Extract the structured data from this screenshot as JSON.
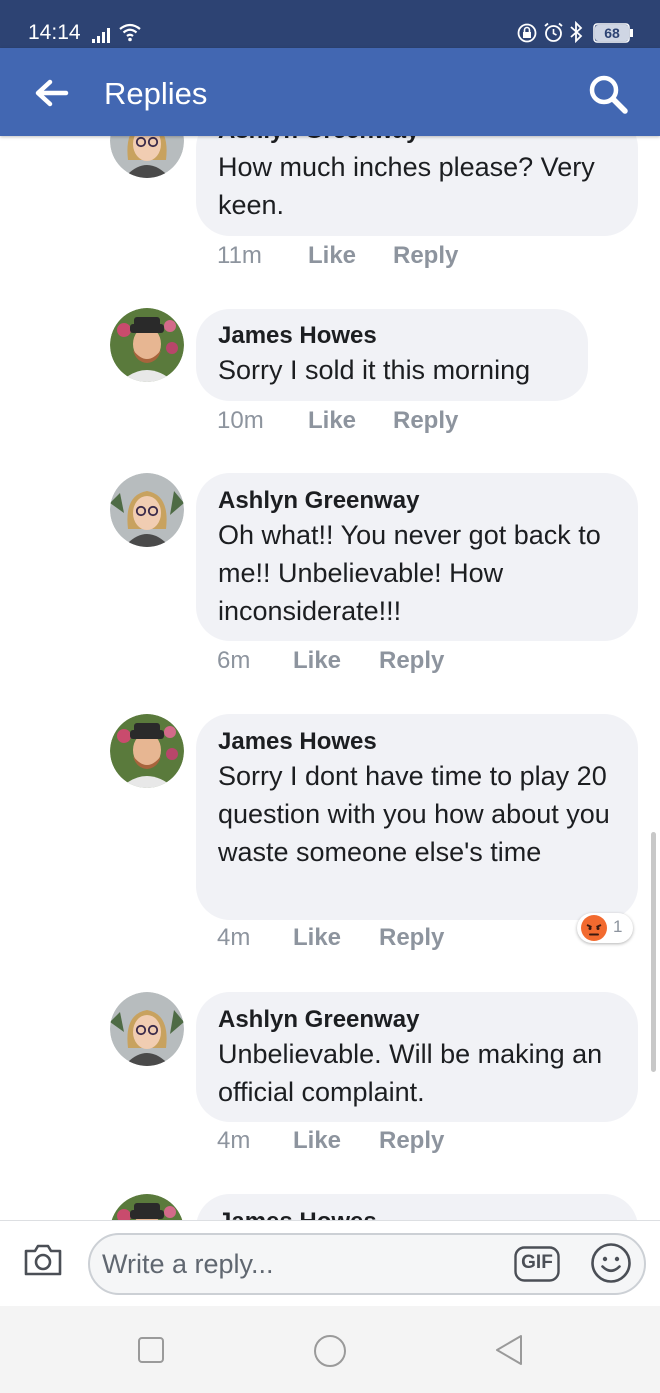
{
  "status_bar": {
    "time": "14:14",
    "battery": "68"
  },
  "header": {
    "title": "Replies"
  },
  "comments": [
    {
      "author": "Ashlyn Greenway",
      "text": "How much inches please? Very keen.",
      "time": "11m",
      "like": "Like",
      "reply": "Reply"
    },
    {
      "author": "James Howes",
      "text": "Sorry I sold it this morning",
      "time": "10m",
      "like": "Like",
      "reply": "Reply"
    },
    {
      "author": "Ashlyn Greenway",
      "text": "Oh what!! You never got back to me!! Unbelievable! How inconsiderate!!!",
      "time": "6m",
      "like": "Like",
      "reply": "Reply"
    },
    {
      "author": "James Howes",
      "text": "Sorry I dont have time to play 20 question with you how about you waste someone else's time",
      "time": "4m",
      "like": "Like",
      "reply": "Reply",
      "reaction": {
        "icon": "angry-emoji-icon",
        "count": "1"
      }
    },
    {
      "author": "Ashlyn Greenway",
      "text": "Unbelievable. Will be making an official complaint.",
      "time": "4m",
      "like": "Like",
      "reply": "Reply"
    },
    {
      "author": "James Howes"
    }
  ],
  "composer": {
    "placeholder": "Write a reply...",
    "gif_label": "GIF"
  },
  "colors": {
    "status_bar": "#2d4373",
    "header": "#4267b2",
    "bubble": "#f1f2f6",
    "meta_text": "#8d949e",
    "angry_reaction": "#f26a2f"
  },
  "icons": [
    "signal-icon",
    "wifi-icon",
    "lock-icon",
    "alarm-icon",
    "bluetooth-icon",
    "battery-icon",
    "back-arrow-icon",
    "search-icon",
    "camera-icon",
    "gif-icon",
    "emoji-icon",
    "angry-emoji-icon",
    "nav-recents-icon",
    "nav-home-icon",
    "nav-back-icon"
  ]
}
